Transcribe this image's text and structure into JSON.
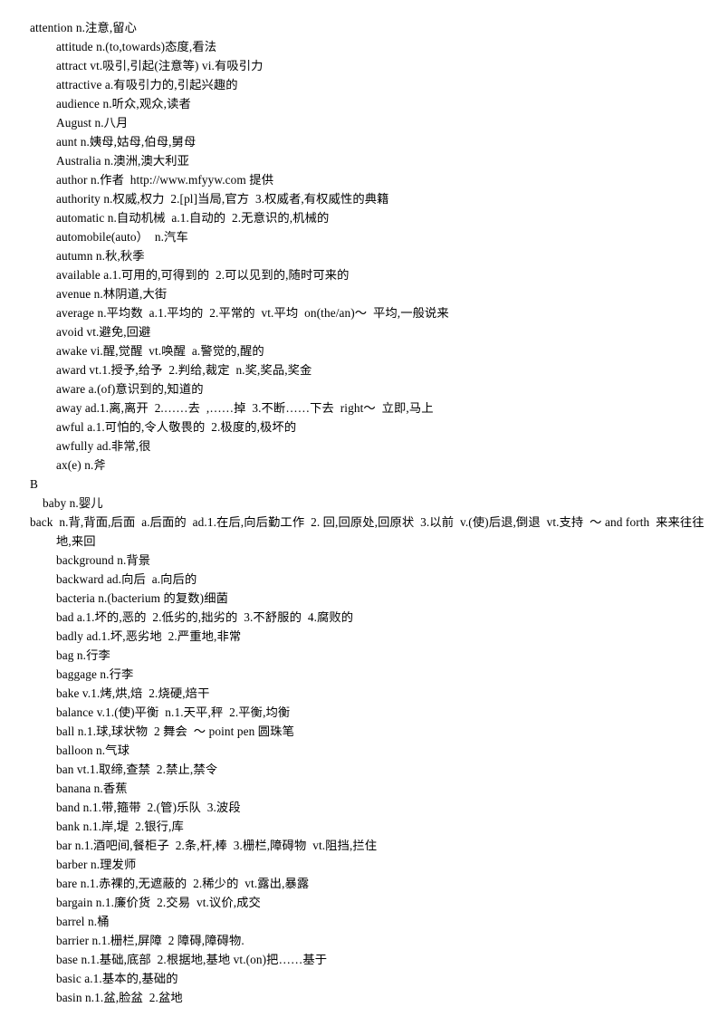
{
  "document": {
    "title": "English-Chinese Vocabulary List",
    "page_background": "#ffffff",
    "text_color": "#000000",
    "watermark_note": "http://www.mfyyw.com 提供"
  },
  "entries": [
    {
      "indent": 0,
      "text": "attention n.注意,留心"
    },
    {
      "indent": 2,
      "text": "attitude n.(to,towards)态度,看法"
    },
    {
      "indent": 2,
      "text": "attract vt.吸引,引起(注意等) vi.有吸引力"
    },
    {
      "indent": 2,
      "text": "attractive a.有吸引力的,引起兴趣的"
    },
    {
      "indent": 2,
      "text": "audience n.听众,观众,读者"
    },
    {
      "indent": 2,
      "text": "August n.八月"
    },
    {
      "indent": 2,
      "text": "aunt n.姨母,姑母,伯母,舅母"
    },
    {
      "indent": 2,
      "text": "Australia n.澳洲,澳大利亚"
    },
    {
      "indent": 2,
      "text": "author n.作者  http://www.mfyyw.com 提供"
    },
    {
      "indent": 2,
      "text": "authority n.权威,权力  2.[pl]当局,官方  3.权威者,有权威性的典籍"
    },
    {
      "indent": 2,
      "text": "automatic n.自动机械  a.1.自动的  2.无意识的,机械的"
    },
    {
      "indent": 2,
      "text": "automobile(auto）  n.汽车"
    },
    {
      "indent": 2,
      "text": "autumn n.秋,秋季"
    },
    {
      "indent": 2,
      "text": "available a.1.可用的,可得到的  2.可以见到的,随时可来的"
    },
    {
      "indent": 2,
      "text": "avenue n.林阴道,大街"
    },
    {
      "indent": 2,
      "text": "average n.平均数  a.1.平均的  2.平常的  vt.平均  on(the/an)～  平均,一般说来"
    },
    {
      "indent": 2,
      "text": "avoid vt.避免,回避"
    },
    {
      "indent": 2,
      "text": "awake vi.醒,觉醒  vt.唤醒  a.警觉的,醒的"
    },
    {
      "indent": 2,
      "text": "award vt.1.授予,给予  2.判给,裁定  n.奖,奖品,奖金"
    },
    {
      "indent": 2,
      "text": "aware a.(of)意识到的,知道的"
    },
    {
      "indent": 2,
      "text": "away ad.1.离,离开  2.……去  ,……掉  3.不断……下去  right～  立即,马上"
    },
    {
      "indent": 2,
      "text": "awful a.1.可怕的,令人敬畏的  2.极度的,极坏的"
    },
    {
      "indent": 2,
      "text": "awfully ad.非常,很"
    },
    {
      "indent": 2,
      "text": "ax(e) n.斧"
    },
    {
      "indent": 0,
      "text": "B",
      "is_section": true
    },
    {
      "indent": 1,
      "text": "baby n.婴儿"
    },
    {
      "indent": 3,
      "text": "back  n.背,背面,后面  a.后面的  ad.1.在后,向后勤工作  2. 回,回原处,回原状  3.以前  v.(使)后退,倒退  vt.支持  ～ and forth  来来往往地,来回"
    },
    {
      "indent": 2,
      "text": "background n.背景"
    },
    {
      "indent": 2,
      "text": "backward ad.向后  a.向后的"
    },
    {
      "indent": 2,
      "text": "bacteria n.(bacterium 的复数)细菌"
    },
    {
      "indent": 2,
      "text": "bad a.1.坏的,恶的  2.低劣的,拙劣的  3.不舒服的  4.腐败的"
    },
    {
      "indent": 2,
      "text": "badly ad.1.坏,恶劣地  2.严重地,非常"
    },
    {
      "indent": 2,
      "text": "bag n.行李"
    },
    {
      "indent": 2,
      "text": "baggage n.行李"
    },
    {
      "indent": 2,
      "text": "bake v.1.烤,烘,焙  2.烧硬,焙干"
    },
    {
      "indent": 2,
      "text": "balance v.1.(使)平衡  n.1.天平,秤  2.平衡,均衡"
    },
    {
      "indent": 2,
      "text": "ball n.1.球,球状物  2 舞会  ～ point pen 圆珠笔"
    },
    {
      "indent": 2,
      "text": "balloon n.气球"
    },
    {
      "indent": 2,
      "text": "ban vt.1.取缔,查禁  2.禁止,禁令"
    },
    {
      "indent": 2,
      "text": "banana n.香蕉"
    },
    {
      "indent": 2,
      "text": "band n.1.带,箍带  2.(管)乐队  3.波段"
    },
    {
      "indent": 2,
      "text": "bank n.1.岸,堤  2.银行,库"
    },
    {
      "indent": 2,
      "text": "bar n.1.酒吧间,餐柜子  2.条,杆,棒  3.栅栏,障碍物  vt.阻挡,拦住"
    },
    {
      "indent": 2,
      "text": "barber n.理发师"
    },
    {
      "indent": 2,
      "text": "bare n.1.赤裸的,无遮蔽的  2.稀少的  vt.露出,暴露"
    },
    {
      "indent": 2,
      "text": "bargain n.1.廉价货  2.交易  vt.议价,成交"
    },
    {
      "indent": 2,
      "text": "barrel n.桶"
    },
    {
      "indent": 2,
      "text": "barrier n.1.栅栏,屏障  2 障碍,障碍物."
    },
    {
      "indent": 2,
      "text": "base n.1.基础,底部  2.根据地,基地 vt.(on)把……基于"
    },
    {
      "indent": 2,
      "text": "basic a.1.基本的,基础的"
    },
    {
      "indent": 2,
      "text": "basin n.1.盆,脸盆  2.盆地"
    }
  ]
}
